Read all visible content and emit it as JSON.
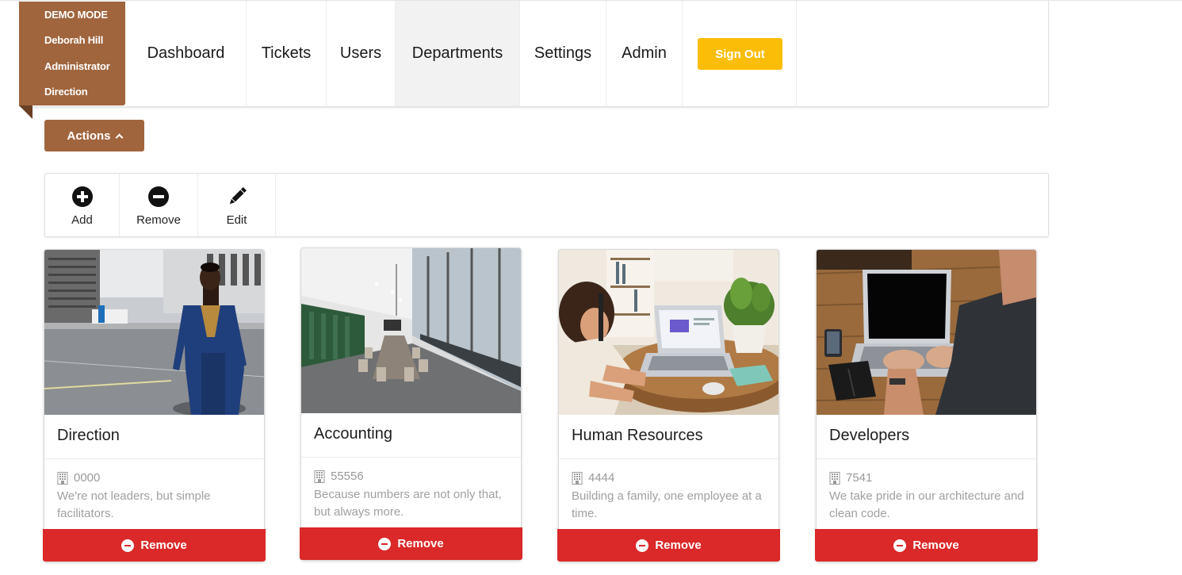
{
  "demo": {
    "mode": "DEMO MODE",
    "user_name": "Deborah Hill",
    "role": "Administrator",
    "department": "Direction"
  },
  "nav": {
    "items": [
      {
        "label": "Dashboard"
      },
      {
        "label": "Tickets"
      },
      {
        "label": "Users"
      },
      {
        "label": "Departments",
        "active": true
      },
      {
        "label": "Settings"
      },
      {
        "label": "Admin"
      }
    ],
    "sign_out": "Sign Out"
  },
  "actions": {
    "label": "Actions"
  },
  "toolbar": {
    "items": [
      {
        "label": "Add",
        "icon": "plus-circle-icon"
      },
      {
        "label": "Remove",
        "icon": "minus-circle-icon"
      },
      {
        "label": "Edit",
        "icon": "pencil-icon"
      }
    ]
  },
  "departments": [
    {
      "name": "Direction",
      "code": "0000",
      "description": "We're not leaders, but simple facilitators.",
      "remove_label": "Remove",
      "photo": "man-in-blue-suit-on-street"
    },
    {
      "name": "Accounting",
      "code": "55556",
      "description": "Because numbers are not only that, but always more.",
      "remove_label": "Remove",
      "photo": "conference-room"
    },
    {
      "name": "Human Resources",
      "code": "4444",
      "description": "Building a family, one employee at a time.",
      "remove_label": "Remove",
      "photo": "woman-at-laptop-with-plant"
    },
    {
      "name": "Developers",
      "code": "7541",
      "description": "We take pride in our architecture and clean code.",
      "remove_label": "Remove",
      "photo": "hands-typing-on-laptop"
    }
  ],
  "colors": {
    "brown_accent": "#a0653d",
    "sign_out_yellow": "#fbbd08",
    "remove_red": "#db2828",
    "active_nav_bg": "#f2f2f2"
  }
}
